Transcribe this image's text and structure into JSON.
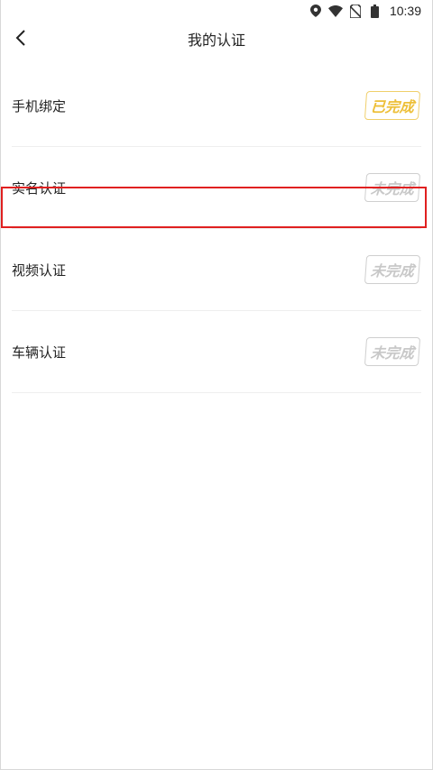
{
  "status_bar": {
    "time": "10:39",
    "icons": [
      "location-icon",
      "wifi-icon",
      "no-sim-icon",
      "battery-icon"
    ]
  },
  "nav": {
    "title": "我的认证",
    "back_icon": "chevron-left-icon"
  },
  "items": [
    {
      "label": "手机绑定",
      "status": "已完成",
      "done": true
    },
    {
      "label": "实名认证",
      "status": "未完成",
      "done": false,
      "highlighted": true
    },
    {
      "label": "视频认证",
      "status": "未完成",
      "done": false
    },
    {
      "label": "车辆认证",
      "status": "未完成",
      "done": false
    }
  ],
  "colors": {
    "done_stamp": "#edbf38",
    "pending_stamp": "#c8c8c8",
    "highlight_border": "#e02020"
  }
}
